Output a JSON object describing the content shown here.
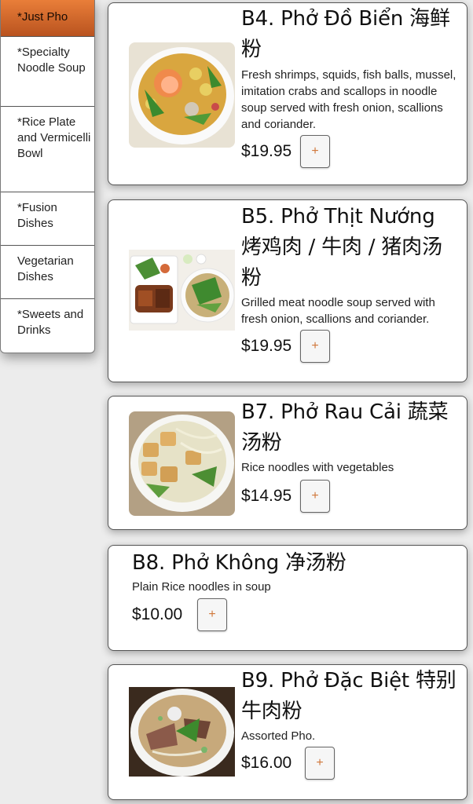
{
  "sidebar": {
    "items": [
      {
        "label": "*Just Pho"
      },
      {
        "label": "*Specialty Noodle Soup"
      },
      {
        "label": "*Rice Plate and Vermicelli Bowl"
      },
      {
        "label": "*Fusion Dishes"
      },
      {
        "label": "Vegetarian Dishes"
      },
      {
        "label": "*Sweets and Drinks"
      }
    ]
  },
  "menu": {
    "add_label": "+",
    "items": [
      {
        "title": "B4. Phở Đồ Biển 海鲜粉",
        "description": "Fresh shrimps, squids, fish balls, mussel, imitation crabs and scallops in noodle soup served with fresh onion, scallions and coriander.",
        "price": "$19.95",
        "image": "seafood-pho-photo"
      },
      {
        "title": "B5. Phở Thịt Nướng 烤鸡肉 / 牛肉 / 猪肉汤粉",
        "description": "Grilled meat noodle soup served with fresh onion, scallions and coriander.",
        "price": "$19.95",
        "image": "grilled-meat-pho-photo"
      },
      {
        "title": "B7. Phở Rau Cải 蔬菜汤粉",
        "description": "Rice noodles with vegetables",
        "price": "$14.95",
        "image": "vegetable-pho-photo"
      },
      {
        "title": "B8. Phở Không 净汤粉",
        "description": "Plain Rice noodles in soup",
        "price": "$10.00",
        "image": ""
      },
      {
        "title": "B9. Phở Đặc Biệt 特别牛肉粉",
        "description": "Assorted Pho.",
        "price": "$16.00",
        "image": "assorted-pho-photo"
      }
    ]
  }
}
